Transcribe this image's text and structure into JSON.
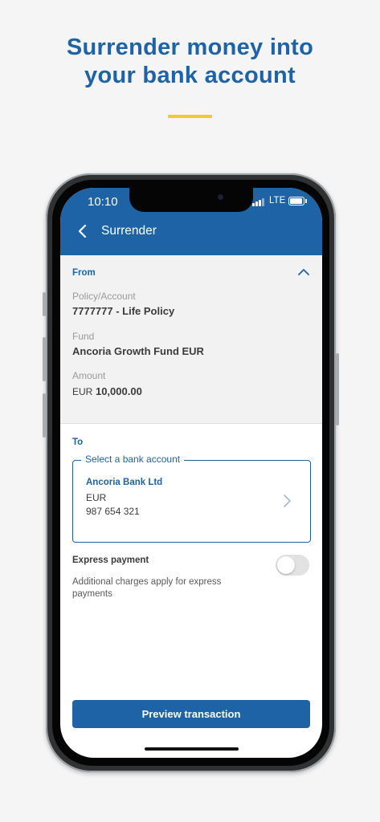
{
  "headline": {
    "line1": "Surrender money into",
    "line2": "your bank account"
  },
  "colors": {
    "brand": "#1d63a5",
    "accent": "#f4c92d",
    "background": "#f5f5f5"
  },
  "status_bar": {
    "time": "10:10",
    "network": "LTE",
    "icons": [
      "signal-icon",
      "battery-icon"
    ]
  },
  "appbar": {
    "title": "Surrender",
    "back_icon": "chevron-left-icon"
  },
  "from": {
    "heading": "From",
    "collapse_icon": "chevron-up-icon",
    "policy_label": "Policy/Account",
    "policy_value": "7777777 - Life Policy",
    "fund_label": "Fund",
    "fund_value": "Ancoria Growth Fund EUR",
    "amount_label": "Amount",
    "amount_currency": "EUR",
    "amount_value": "10,000.00"
  },
  "to": {
    "heading": "To",
    "select_label": "Select a bank account",
    "bank_name": "Ancoria Bank Ltd",
    "bank_currency": "EUR",
    "bank_number": "987 654 321",
    "open_icon": "chevron-right-icon"
  },
  "express": {
    "title": "Express payment",
    "description": "Additional charges apply for express payments",
    "enabled": false
  },
  "actions": {
    "preview_label": "Preview transaction"
  }
}
